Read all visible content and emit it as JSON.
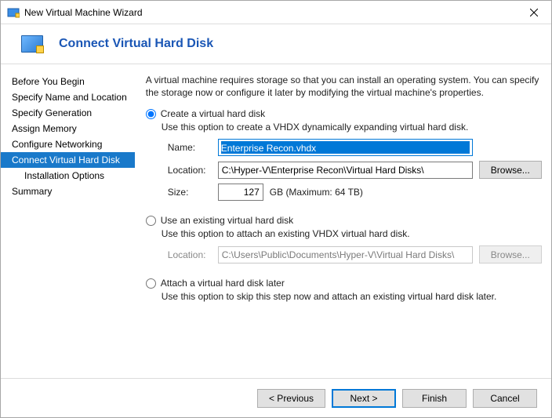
{
  "window": {
    "title": "New Virtual Machine Wizard"
  },
  "header": {
    "title": "Connect Virtual Hard Disk"
  },
  "sidebar": {
    "items": [
      {
        "label": "Before You Begin"
      },
      {
        "label": "Specify Name and Location"
      },
      {
        "label": "Specify Generation"
      },
      {
        "label": "Assign Memory"
      },
      {
        "label": "Configure Networking"
      },
      {
        "label": "Connect Virtual Hard Disk"
      },
      {
        "label": "Installation Options"
      },
      {
        "label": "Summary"
      }
    ]
  },
  "content": {
    "intro": "A virtual machine requires storage so that you can install an operating system. You can specify the storage now or configure it later by modifying the virtual machine's properties.",
    "option_create": {
      "title": "Create a virtual hard disk",
      "desc": "Use this option to create a VHDX dynamically expanding virtual hard disk.",
      "name_label": "Name:",
      "name_value": "Enterprise Recon.vhdx",
      "location_label": "Location:",
      "location_value": "C:\\Hyper-V\\Enterprise Recon\\Virtual Hard Disks\\",
      "browse_label": "Browse...",
      "size_label": "Size:",
      "size_value": "127",
      "size_suffix": "GB (Maximum: 64 TB)"
    },
    "option_existing": {
      "title": "Use an existing virtual hard disk",
      "desc": "Use this option to attach an existing VHDX virtual hard disk.",
      "location_label": "Location:",
      "location_value": "C:\\Users\\Public\\Documents\\Hyper-V\\Virtual Hard Disks\\",
      "browse_label": "Browse..."
    },
    "option_later": {
      "title": "Attach a virtual hard disk later",
      "desc": "Use this option to skip this step now and attach an existing virtual hard disk later."
    }
  },
  "footer": {
    "previous": "< Previous",
    "next": "Next >",
    "finish": "Finish",
    "cancel": "Cancel"
  }
}
